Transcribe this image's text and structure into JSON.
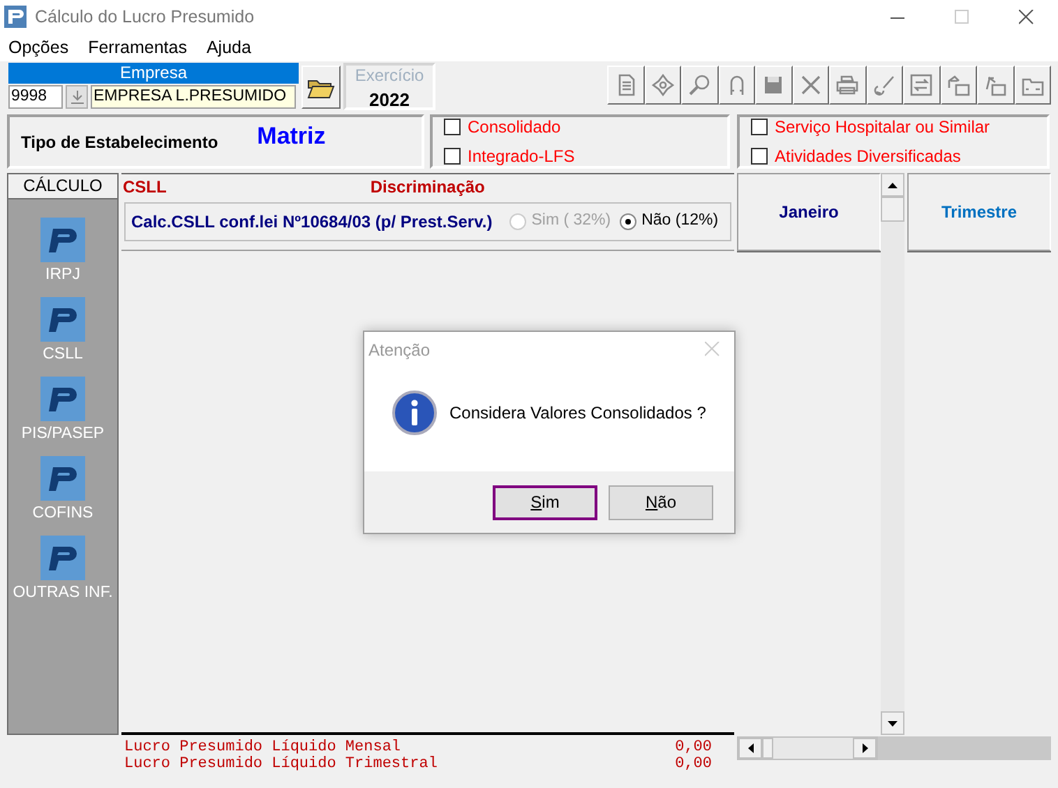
{
  "window": {
    "title": "Cálculo do Lucro Presumido"
  },
  "menu": [
    "Opções",
    "Ferramentas",
    "Ajuda"
  ],
  "empresa": {
    "label": "Empresa",
    "code": "9998",
    "name": "EMPRESA L.PRESUMIDO"
  },
  "exercicio": {
    "label": "Exercício",
    "value": "2022"
  },
  "establishment": {
    "label": "Tipo de Estabelecimento",
    "value": "Matriz"
  },
  "options": [
    {
      "label": "Consolidado",
      "checked": false
    },
    {
      "label": "Integrado-LFS",
      "checked": false
    }
  ],
  "activities": [
    {
      "label": "Serviço Hospitalar ou Similar",
      "checked": false
    },
    {
      "label": "Atividades Diversificadas",
      "checked": false
    }
  ],
  "sidebar": {
    "header": "CÁLCULO",
    "items": [
      "IRPJ",
      "CSLL",
      "PIS/PASEP",
      "COFINS",
      "OUTRAS INF."
    ]
  },
  "grid": {
    "tax": "CSLL",
    "heading": "Discriminação",
    "rows": [
      {
        "label": "Calc.CSLL conf.lei  Nº10684/03 (p/ Prest.Serv.)",
        "choices": [
          {
            "label": "Sim ( 32%)",
            "selected": false,
            "disabled": true
          },
          {
            "label": "Não (12%)",
            "selected": true,
            "disabled": false
          }
        ]
      }
    ],
    "columns": [
      "Janeiro",
      "Trimestre"
    ]
  },
  "totals": [
    {
      "label": "Lucro Presumido Líquido Mensal",
      "value": "0,00"
    },
    {
      "label": "Lucro Presumido Líquido Trimestral",
      "value": "0,00"
    }
  ],
  "dialog": {
    "title": "Atenção",
    "message": "Considera Valores Consolidados ?",
    "buttons": [
      {
        "label": "Sim",
        "focused": true
      },
      {
        "label": "Não",
        "focused": false
      }
    ]
  }
}
